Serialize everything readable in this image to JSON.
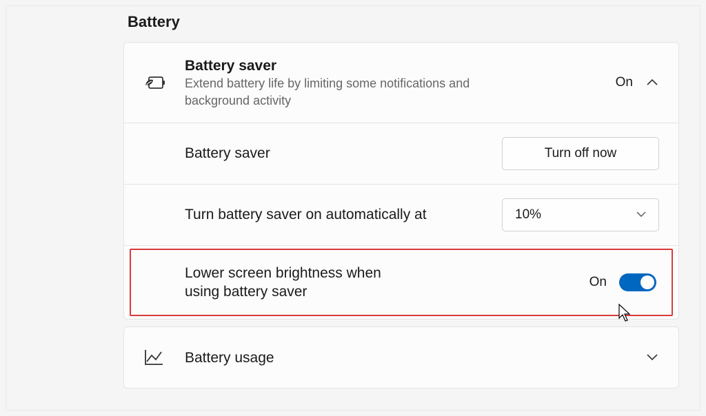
{
  "section_title": "Battery",
  "battery_saver": {
    "title": "Battery saver",
    "subtitle": "Extend battery life by limiting some notifications and background activity",
    "status": "On",
    "rows": {
      "toggle_row": {
        "label": "Battery saver",
        "button": "Turn off now"
      },
      "auto_row": {
        "label": "Turn battery saver on automatically at",
        "value": "10%"
      },
      "brightness_row": {
        "label": "Lower screen brightness when using battery saver",
        "status": "On"
      }
    }
  },
  "battery_usage": {
    "title": "Battery usage"
  }
}
